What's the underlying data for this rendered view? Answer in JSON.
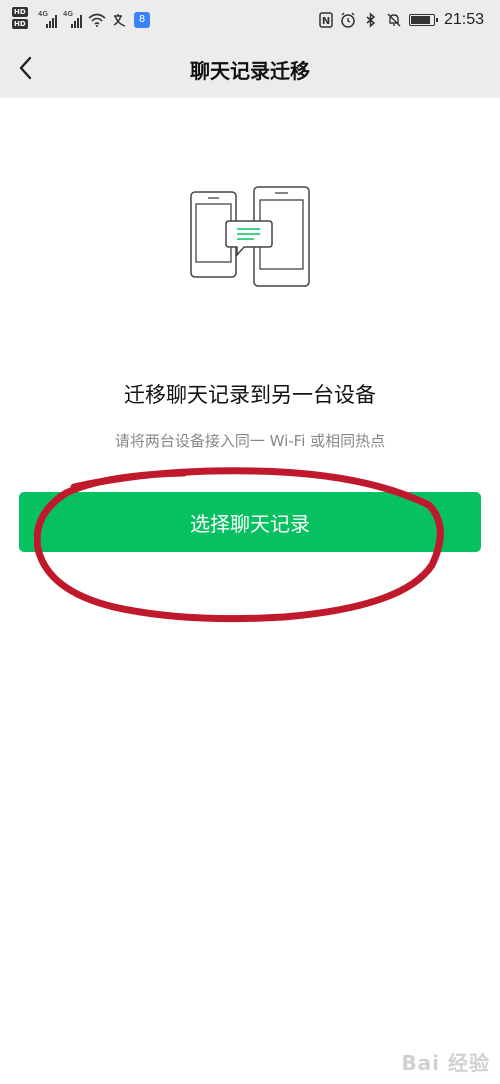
{
  "status_bar": {
    "hd_badges": [
      "HD",
      "HD"
    ],
    "signal_tags": [
      "4G",
      "4G"
    ],
    "app_icon_glyph": "8",
    "nfc_label": "N",
    "time": "21:53",
    "battery_level": 0.8
  },
  "header": {
    "title": "聊天记录迁移",
    "back_icon": "chevron-left-icon"
  },
  "main": {
    "illustration_icon": "phone-transfer-icon",
    "heading": "迁移聊天记录到另一台设备",
    "subtext": "请将两台设备接入同一 Wi-Fi 或相同热点",
    "primary_button_label": "选择聊天记录"
  },
  "colors": {
    "accent": "#07c160",
    "annotation": "#c0192b",
    "bar_background": "#ececec"
  },
  "watermark": {
    "text": "Bai 经验"
  }
}
